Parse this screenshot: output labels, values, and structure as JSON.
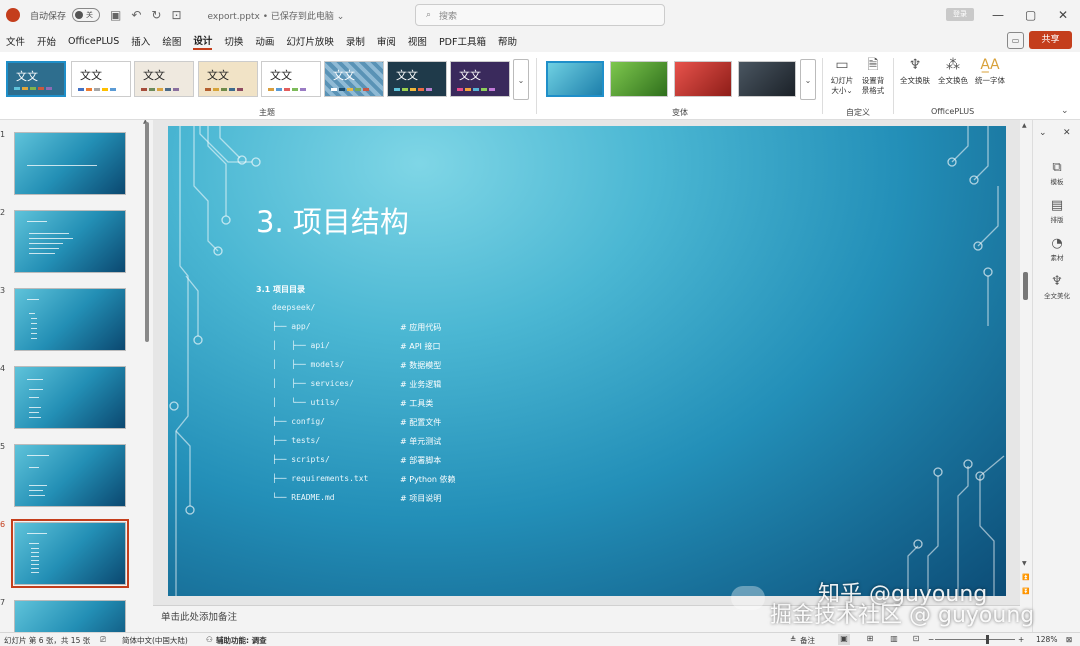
{
  "titlebar": {
    "autosave_label": "自动保存",
    "autosave_state": "关",
    "doc_title": "export.pptx • 已保存到此电脑 ⌄",
    "search_placeholder": "搜索",
    "login_label": "登录"
  },
  "menu": {
    "items": [
      "文件",
      "开始",
      "OfficePLUS",
      "插入",
      "绘图",
      "设计",
      "切换",
      "动画",
      "幻灯片放映",
      "录制",
      "审阅",
      "视图",
      "PDF工具箱",
      "帮助"
    ],
    "active": "设计",
    "share_label": "共享"
  },
  "ribbon": {
    "theme_text": "文文",
    "groups": {
      "themes": "主题",
      "variants": "变体",
      "customize": "自定义",
      "officeplus": "OfficePLUS"
    },
    "tools": {
      "slide_size": "幻灯片\n大小⌄",
      "format_bg": "设置背\n景格式",
      "swap_all": "全文换肤",
      "recolor_all": "全文换色",
      "unify_font": "统一字体"
    },
    "theme_colors": [
      "#2e6e8e",
      "#ffffff",
      "#efe9df",
      "#f1e3c6",
      "#ffffff",
      "#5a93b6",
      "#1f3a4a",
      "#3a2a5c"
    ],
    "variant_colors": [
      "#3a9fc6",
      "#4d9b2f",
      "#c7342e",
      "#2a333c"
    ]
  },
  "thumbnails": {
    "numbers": [
      "1",
      "2",
      "3",
      "4",
      "5",
      "6",
      "7"
    ],
    "selected": "6"
  },
  "slide": {
    "title": "3. 项目结构",
    "subheading": "3.1 项目目录",
    "root": "deepseek/",
    "tree": [
      {
        "path": "├── app/",
        "comment": "# 应用代码"
      },
      {
        "path": "│   ├── api/",
        "comment": "# API 接口"
      },
      {
        "path": "│   ├── models/",
        "comment": "# 数据模型"
      },
      {
        "path": "│   ├── services/",
        "comment": "# 业务逻辑"
      },
      {
        "path": "│   └── utils/",
        "comment": "# 工具类"
      },
      {
        "path": "├── config/",
        "comment": "# 配置文件"
      },
      {
        "path": "├── tests/",
        "comment": "# 单元测试"
      },
      {
        "path": "├── scripts/",
        "comment": "# 部署脚本"
      },
      {
        "path": "├── requirements.txt",
        "comment": "# Python 依赖"
      },
      {
        "path": "└── README.md",
        "comment": "# 项目说明"
      }
    ]
  },
  "notes": {
    "placeholder": "单击此处添加备注"
  },
  "sidepane": {
    "items": [
      "模板",
      "排版",
      "素材",
      "全文美化"
    ]
  },
  "statusbar": {
    "slide_info": "幻灯片 第 6 张，共 15 张",
    "language": "简体中文(中国大陆)",
    "accessibility": "辅助功能: 调查",
    "notes_btn": "备注",
    "zoom": "128%"
  },
  "watermarks": {
    "line1": "知乎 @guyoung",
    "line2": "掘金技术社区 @ guyoung"
  }
}
